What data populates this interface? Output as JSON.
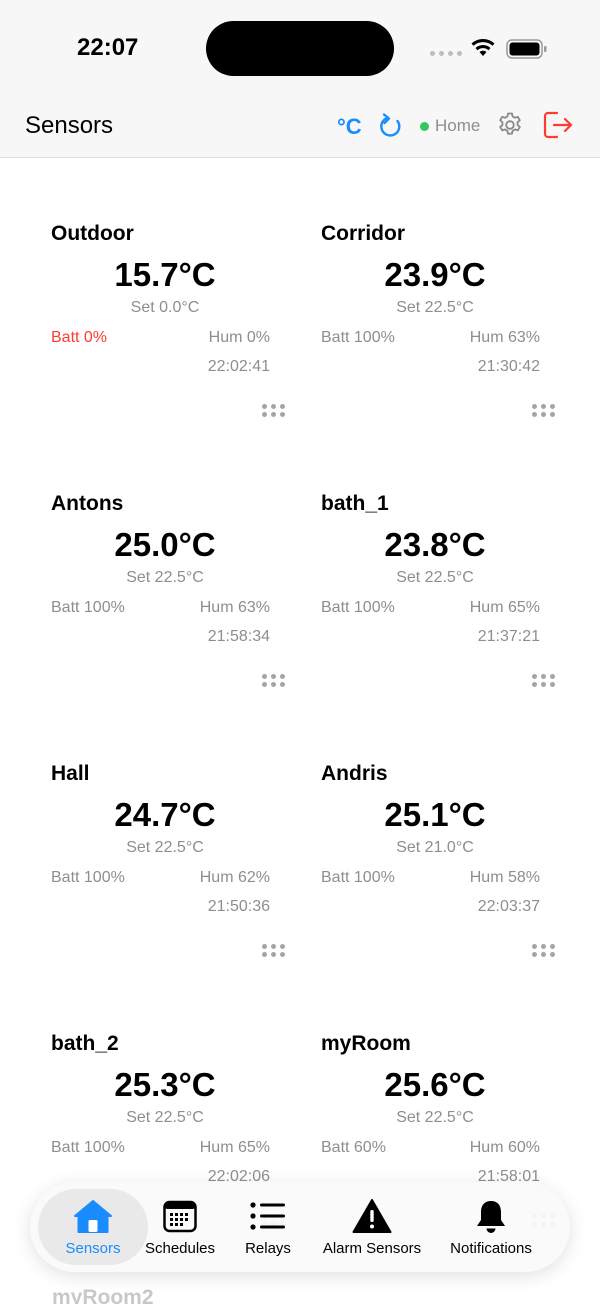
{
  "status_bar": {
    "time": "22:07"
  },
  "header": {
    "title": "Sensors",
    "unit": "°C",
    "connection": "Home",
    "colors": {
      "accent": "#1a8cff",
      "online": "#34c759",
      "logout": "#ff3b30"
    }
  },
  "sensors": [
    {
      "name": "Outdoor",
      "temp": "15.7°C",
      "setpoint": "Set 0.0°C",
      "battery": "Batt 0%",
      "battery_low": true,
      "humidity": "Hum 0%",
      "time": "22:02:41"
    },
    {
      "name": "Corridor",
      "temp": "23.9°C",
      "setpoint": "Set 22.5°C",
      "battery": "Batt 100%",
      "battery_low": false,
      "humidity": "Hum 63%",
      "time": "21:30:42"
    },
    {
      "name": "Antons",
      "temp": "25.0°C",
      "setpoint": "Set 22.5°C",
      "battery": "Batt 100%",
      "battery_low": false,
      "humidity": "Hum 63%",
      "time": "21:58:34"
    },
    {
      "name": "bath_1",
      "temp": "23.8°C",
      "setpoint": "Set 22.5°C",
      "battery": "Batt 100%",
      "battery_low": false,
      "humidity": "Hum 65%",
      "time": "21:37:21"
    },
    {
      "name": "Hall",
      "temp": "24.7°C",
      "setpoint": "Set 22.5°C",
      "battery": "Batt 100%",
      "battery_low": false,
      "humidity": "Hum 62%",
      "time": "21:50:36"
    },
    {
      "name": "Andris",
      "temp": "25.1°C",
      "setpoint": "Set 21.0°C",
      "battery": "Batt 100%",
      "battery_low": false,
      "humidity": "Hum 58%",
      "time": "22:03:37"
    },
    {
      "name": "bath_2",
      "temp": "25.3°C",
      "setpoint": "Set 22.5°C",
      "battery": "Batt 100%",
      "battery_low": false,
      "humidity": "Hum 65%",
      "time": "22:02:06"
    },
    {
      "name": "myRoom",
      "temp": "25.6°C",
      "setpoint": "Set 22.5°C",
      "battery": "Batt 60%",
      "battery_low": false,
      "humidity": "Hum 60%",
      "time": "21:58:01"
    }
  ],
  "next_sensor_peek": "myRoom2",
  "tabbar": {
    "items": [
      {
        "label": "Sensors",
        "icon": "house-icon",
        "active": true
      },
      {
        "label": "Schedules",
        "icon": "calendar-icon",
        "active": false
      },
      {
        "label": "Relays",
        "icon": "list-icon",
        "active": false
      },
      {
        "label": "Alarm Sensors",
        "icon": "warning-icon",
        "active": false
      },
      {
        "label": "Notifications",
        "icon": "bell-icon",
        "active": false
      }
    ]
  }
}
